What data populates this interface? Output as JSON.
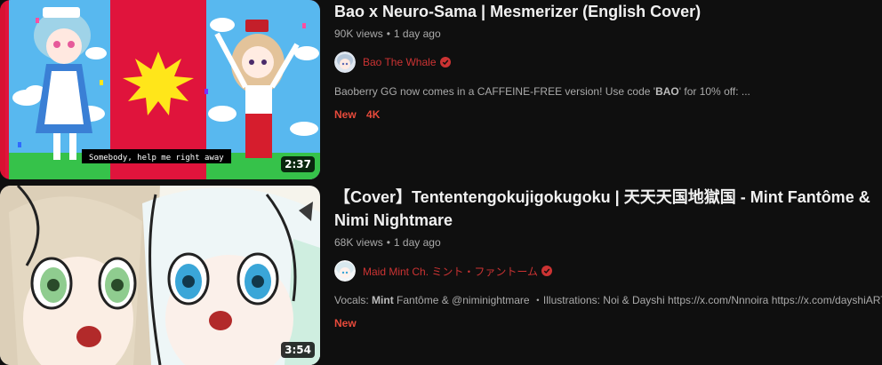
{
  "videos": [
    {
      "title": "Bao x Neuro-Sama | Mesmerizer (English Cover)",
      "views": "90K views",
      "age": "1 day ago",
      "channel": "Bao The Whale",
      "verified": true,
      "description_prefix": "Baoberry GG now comes in a CAFFEINE-FREE version! Use code '",
      "description_bold": "BAO",
      "description_suffix": "' for 10% off: ...",
      "badges": [
        "New",
        "4K"
      ],
      "duration": "2:37",
      "thumbnail_subtitle": "Somebody, help me right away"
    },
    {
      "title": "【Cover】Tententengokujigokugoku | 天天天国地獄国 - Mint Fantôme & Nimi Nightmare",
      "views": "68K views",
      "age": "1 day ago",
      "channel": "Maid Mint Ch. ミント・ファントーム",
      "verified": true,
      "description_prefix": "Vocals: ",
      "description_bold": "Mint",
      "description_suffix": " Fantôme & @niminightmare ・Illustrations: Noi & Dayshi https://x.com/Nnnoira https://x.com/dayshiART",
      "badges": [
        "New"
      ],
      "duration": "3:54"
    }
  ],
  "separator": "•",
  "colors": {
    "background": "#0f0f0f",
    "title": "#f1f1f1",
    "meta": "#aaaaaa",
    "channel_accent": "#cc3333",
    "badge": "#e74a3b"
  },
  "icons": {
    "verified": "check-circle-icon"
  }
}
